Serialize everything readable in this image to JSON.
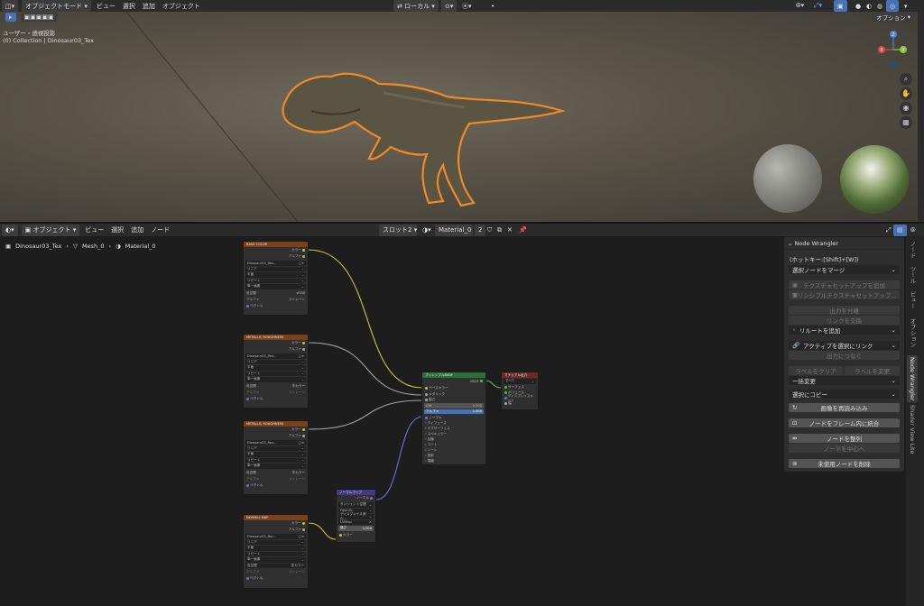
{
  "top_header": {
    "mode": "オブジェクトモード",
    "menus": [
      "ビュー",
      "選択",
      "追加",
      "オブジェクト"
    ],
    "transform_orientation": "ローカル",
    "options_label": "オプション"
  },
  "viewport": {
    "view_name": "ユーザー・透視投影",
    "collection_text": "(0) Collection | Dinosaur03_Tex",
    "gizmo_axes": [
      "X",
      "Y",
      "Z"
    ]
  },
  "node_header": {
    "mode": "オブジェクト",
    "menus": [
      "ビュー",
      "選択",
      "追加",
      "ノード"
    ],
    "slot": "スロット2",
    "material": "Material_0",
    "users": "2"
  },
  "breadcrumb": {
    "items": [
      "Dinosaur03_Tex",
      "Mesh_0",
      "Material_0"
    ]
  },
  "nodes": {
    "tex_common": {
      "rows": [
        "リニア",
        "平面",
        "リピート",
        "単一画像"
      ],
      "colorspace_label": "色空間",
      "alpha_label": "アルファ",
      "alpha_value": "ストレート",
      "vector": "ベクトル",
      "out_color": "カラー",
      "out_alpha": "アルファ"
    },
    "base": {
      "title": "BASE COLOR",
      "file": "Dinosaur03_Bas...",
      "colorspace": "sRGB"
    },
    "metal1": {
      "title": "METALLIC ROUGHNESS",
      "file": "Dinosaur03_Met...",
      "colorspace": "非カラー"
    },
    "metal2": {
      "title": "METALLIC ROUGHNESS",
      "file": "Dinosaur03_Rou...",
      "colorspace": "非カラー"
    },
    "normal": {
      "title": "NORMAL MAP",
      "file": "Dinosaur03_Nor...",
      "colorspace": "非カラー"
    },
    "bsdf": {
      "title": "プリンシプルBSDF",
      "out": "BSDF",
      "inputs": [
        "ベースカラー",
        "メタリック",
        "粗さ",
        "IOR",
        "アルファ",
        "ノーマル"
      ],
      "ior_value": "1.500",
      "alpha_value": "1.000",
      "panels": [
        "ディフューズ",
        "サブサーフェス",
        "スペキュラー",
        "伝播",
        "コート",
        "シーン",
        "放射",
        "薄膜"
      ]
    },
    "output": {
      "title": "マテリアル出力",
      "target": "すべて",
      "inputs": [
        "サーフェス",
        "ボリューム",
        "ディスプレイスメント",
        "幅"
      ]
    },
    "normalmap": {
      "title": "ノーマルマップ",
      "out": "ノーマル",
      "space": "タンジェント空間",
      "convention": "OpenGL",
      "uv_label": "ディスプレイス済の...",
      "uv": "UVMap",
      "strength_label": "強さ",
      "strength_value": "1.000",
      "in_color": "カラー"
    }
  },
  "panel": {
    "title": "Node Wrangler",
    "hotkey": "(ホットキー:[Shift]+[W])",
    "merge_select": "選択ノードをマージ",
    "tex_setup": "テクスチャセットアップを追加",
    "principled_setup": "プリンシプルテクスチャセットアップ...",
    "split_output": "出力を分離",
    "swap_links": "リンクを交換",
    "add_reroute": "リルートを追加",
    "link_active": "アクティブを選択にリンク",
    "connect_output": "出力につなぐ",
    "clear_label": "ラベルをクリア",
    "modify_label": "ラベルを変更",
    "batch_change": "一括変更",
    "copy_selected": "選択にコピー",
    "reload_images": "画像を再読み込み",
    "frame_selected": "ノードをフレーム内に統合",
    "align_nodes": "ノードを整列",
    "center_nodes": "ノードを中心へ",
    "delete_unused": "未使用ノードを削除"
  },
  "side_tabs": [
    "ノード",
    "ツール",
    "ビュー",
    "オプション",
    "Node Wrangler",
    "Shader View Lite"
  ],
  "colors": {
    "accent": "#4772b3",
    "selection_orange": "#f08a28",
    "tex_header": "#7b4019",
    "shader_header": "#2e6e3a",
    "output_header": "#6e2a2a",
    "vector_header": "#3b3b86",
    "link_yellow": "#c7c43a",
    "link_gray": "#a3a3a3",
    "link_purple": "#6e6edc",
    "link_green": "#4fb84f"
  }
}
